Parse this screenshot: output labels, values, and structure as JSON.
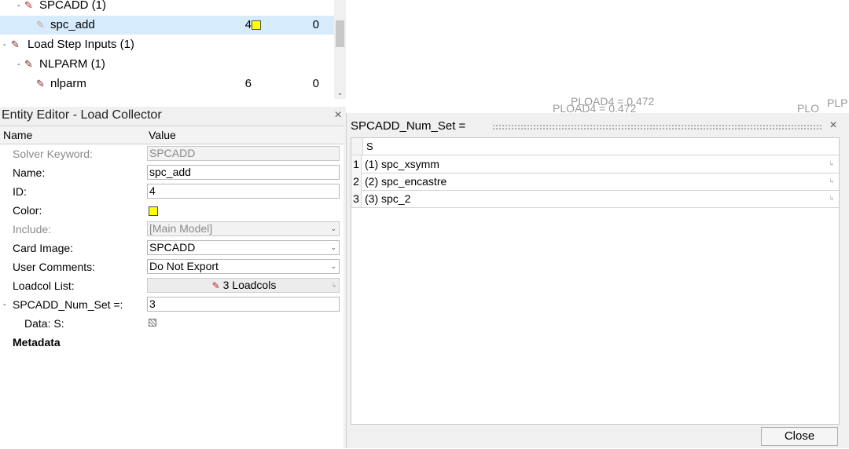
{
  "tree": {
    "rows": [
      {
        "expander": "-",
        "icon": "load-collector-icon",
        "label": "SPCADD (1)"
      },
      {
        "icon": "load-collector-icon",
        "label": "spc_add",
        "id": "4",
        "value": "0",
        "color": "#ffff00"
      },
      {
        "expander": "-",
        "icon": "load-step-inputs-icon",
        "label": "Load Step Inputs (1)"
      },
      {
        "expander": "-",
        "icon": "load-collector-icon",
        "label": "NLPARM (1)"
      },
      {
        "icon": "load-collector-icon",
        "label": "nlparm",
        "id": "6",
        "value": "0"
      }
    ]
  },
  "viewport": {
    "label_a": "PLOAD4 = 0.472",
    "label_b": "PLOAD4 = 0.472",
    "label_c": "PLO",
    "label_d": "PLP"
  },
  "editor": {
    "title": "Entity Editor - Load Collector",
    "close": "×",
    "col_name": "Name",
    "col_value": "Value",
    "rows": {
      "solver_keyword": {
        "label": "Solver Keyword:",
        "value": "SPCADD"
      },
      "name": {
        "label": "Name:",
        "value": "spc_add"
      },
      "id": {
        "label": "ID:",
        "value": "4"
      },
      "color": {
        "label": "Color:",
        "value": "#ffff00"
      },
      "include": {
        "label": "Include:",
        "value": "[Main Model]"
      },
      "card_image": {
        "label": "Card Image:",
        "value": "SPCADD"
      },
      "user_comments": {
        "label": "User Comments:",
        "value": "Do Not Export"
      },
      "loadcol_list": {
        "label": "Loadcol List:",
        "value": "3 Loadcols"
      },
      "num_set": {
        "expander": "-",
        "label": "SPCADD_Num_Set =:",
        "value": "3"
      },
      "data_s": {
        "label": "Data: S:"
      },
      "metadata": {
        "label": "Metadata"
      }
    }
  },
  "popup": {
    "title": "SPCADD_Num_Set =",
    "close": "×",
    "column": "S",
    "rows": [
      {
        "index": "1",
        "value": "(1) spc_xsymm"
      },
      {
        "index": "2",
        "value": "(2) spc_encastre"
      },
      {
        "index": "3",
        "value": "(3) spc_2"
      }
    ],
    "close_button": "Close"
  }
}
